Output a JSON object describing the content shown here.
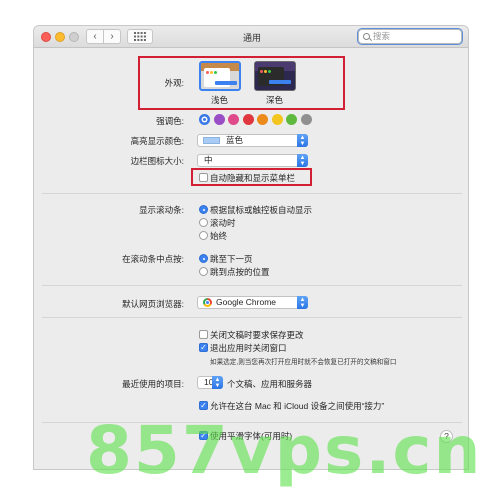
{
  "window": {
    "title": "通用",
    "search_placeholder": "搜索"
  },
  "appearance": {
    "label": "外观:",
    "options": [
      "浅色",
      "深色"
    ]
  },
  "accent": {
    "label": "强调色:",
    "colors": [
      "#3a78e6",
      "#9a4ec6",
      "#df4a8b",
      "#e0373f",
      "#ec8a1c",
      "#f3c51f",
      "#5fb93e",
      "#909090"
    ]
  },
  "highlight": {
    "label": "高亮显示颜色:",
    "value": "蓝色"
  },
  "sidebar_icon": {
    "label": "边栏图标大小:",
    "value": "中"
  },
  "autohide_menubar": {
    "label": "自动隐藏和显示菜单栏",
    "checked": false
  },
  "scrollbars": {
    "label": "显示滚动条:",
    "options": [
      "根据鼠标或触控板自动显示",
      "滚动时",
      "始终"
    ],
    "selected": 0
  },
  "scroll_click": {
    "label": "在滚动条中点按:",
    "options": [
      "跳至下一页",
      "跳到点按的位置"
    ],
    "selected": 0
  },
  "browser": {
    "label": "默认网页浏览器:",
    "value": "Google Chrome"
  },
  "documents": {
    "ask_keep": "关闭文稿时要求保存更改",
    "close_windows": "退出应用时关闭窗口",
    "close_windows_note": "如果选定,则当您再次打开应用时就不会恢复已打开的文稿和窗口"
  },
  "recent": {
    "label": "最近使用的项目:",
    "value": "10",
    "suffix": "个文稿、应用和服务器"
  },
  "handoff": {
    "label": "允许在这台 Mac 和 iCloud 设备之间使用“接力”"
  },
  "font_smoothing": {
    "label": "使用平滑字体(可用时)"
  },
  "help_label": "?",
  "watermark": "857vps.cn"
}
